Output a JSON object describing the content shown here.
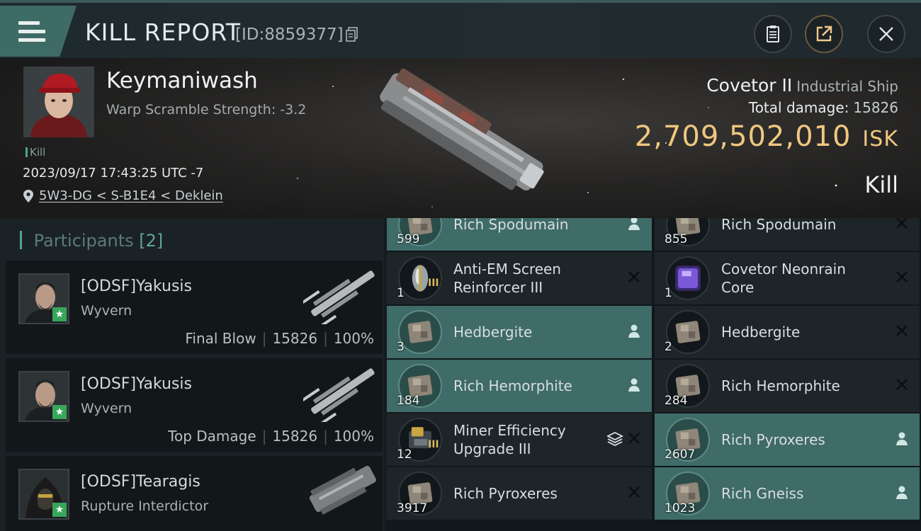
{
  "header": {
    "title": "KILL REPORT",
    "id_text": "[ID:8859377]"
  },
  "victim": {
    "name": "Keymaniwash",
    "warp_scramble": "Warp Scramble Strength: -3.2",
    "kill_tag": "Kill",
    "datetime": "2023/09/17 17:43:25 UTC -7",
    "location": "5W3-DG < S-B1E4 < Deklein",
    "ship_name": "Covetor II",
    "ship_class": "Industrial Ship",
    "total_damage_label": "Total damage:",
    "total_damage": "15826",
    "isk_value": "2,709,502,010",
    "isk_unit": "ISK",
    "result": "Kill"
  },
  "participants": {
    "label": "Participants",
    "count": "[2]",
    "list": [
      {
        "name": "[ODSF]Yakusis",
        "ship": "Wyvern",
        "role": "Final Blow",
        "damage": "15826",
        "percent": "100%"
      },
      {
        "name": "[ODSF]Yakusis",
        "ship": "Wyvern",
        "role": "Top Damage",
        "damage": "15826",
        "percent": "100%"
      },
      {
        "name": "[ODSF]Tearagis",
        "ship": "Rupture Interdictor"
      }
    ]
  },
  "items": [
    {
      "qty": "599",
      "name": "Rich Spodumain",
      "dropped": true,
      "icon": "ore-icon"
    },
    {
      "qty": "855",
      "name": "Rich Spodumain",
      "dropped": false,
      "icon": "ore-icon"
    },
    {
      "qty": "1",
      "level": "III",
      "name": "Anti-EM Screen Reinforcer III",
      "dropped": false,
      "icon": "rig-icon"
    },
    {
      "qty": "1",
      "name": "Covetor Neonrain Core",
      "dropped": false,
      "icon": "core-icon"
    },
    {
      "qty": "3",
      "name": "Hedbergite",
      "dropped": true,
      "icon": "ore-icon"
    },
    {
      "qty": "2",
      "name": "Hedbergite",
      "dropped": false,
      "icon": "ore-icon"
    },
    {
      "qty": "184",
      "name": "Rich Hemorphite",
      "dropped": true,
      "icon": "ore-icon"
    },
    {
      "qty": "284",
      "name": "Rich Hemorphite",
      "dropped": false,
      "icon": "ore-icon"
    },
    {
      "qty": "12",
      "level": "III",
      "name": "Miner Efficiency Upgrade III",
      "dropped": false,
      "stack": true,
      "icon": "upgrade-icon"
    },
    {
      "qty": "2607",
      "name": "Rich Pyroxeres",
      "dropped": true,
      "icon": "ore-icon"
    },
    {
      "qty": "3917",
      "name": "Rich Pyroxeres",
      "dropped": false,
      "icon": "ore-icon"
    },
    {
      "qty": "1023",
      "name": "Rich Gneiss",
      "dropped": true,
      "icon": "ore-icon"
    }
  ],
  "colors": {
    "accent_teal": "#3f6b68",
    "isk_gold": "#f0c77f",
    "kill_green": "#4aa68f"
  }
}
